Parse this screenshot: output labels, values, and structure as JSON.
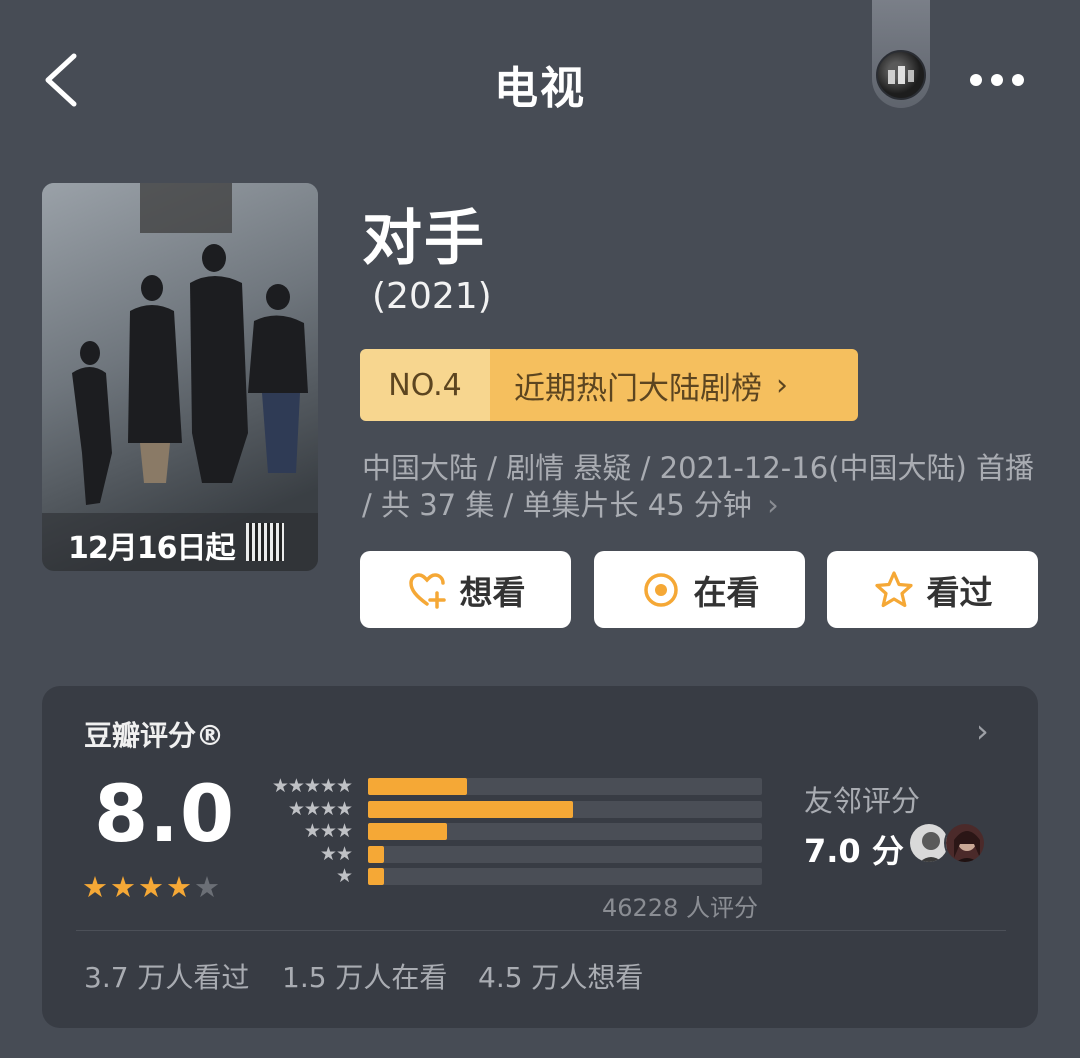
{
  "header": {
    "title": "电视"
  },
  "poster": {
    "date_text": "12月16日起"
  },
  "show": {
    "title": "对手",
    "year": "(2021)"
  },
  "ranking": {
    "number": "NO.4",
    "label": "近期热门大陆剧榜",
    "chevron": "›"
  },
  "meta": {
    "text": "中国大陆 / 剧情 悬疑 / 2021-12-16(中国大陆) 首播 / 共 37 集 / 单集片长 45 分钟",
    "chevron": "›"
  },
  "actions": [
    {
      "label": "想看",
      "icon": "heart-plus-icon"
    },
    {
      "label": "在看",
      "icon": "target-icon"
    },
    {
      "label": "看过",
      "icon": "star-outline-icon"
    }
  ],
  "rating": {
    "title": "豆瓣评分®",
    "score": "8.0",
    "stars_filled": 4,
    "stars_total": 5,
    "distribution": [
      {
        "stars": "★★★★★",
        "fraction": 0.25
      },
      {
        "stars": "★★★★",
        "fraction": 0.52
      },
      {
        "stars": "★★★",
        "fraction": 0.2
      },
      {
        "stars": "★★",
        "fraction": 0.04
      },
      {
        "stars": "★",
        "fraction": 0.04
      }
    ],
    "count_text": "46228 人评分",
    "friend_label": "友邻评分",
    "friend_score": "7.0 分",
    "stats": [
      "3.7 万人看过",
      "1.5 万人在看",
      "4.5 万人想看"
    ]
  },
  "colors": {
    "background": "#474c55",
    "card": "#383c44",
    "accent_orange": "#f5a836",
    "rank_pill_light": "#f7d68f",
    "rank_pill_dark": "#f5bf5e"
  }
}
